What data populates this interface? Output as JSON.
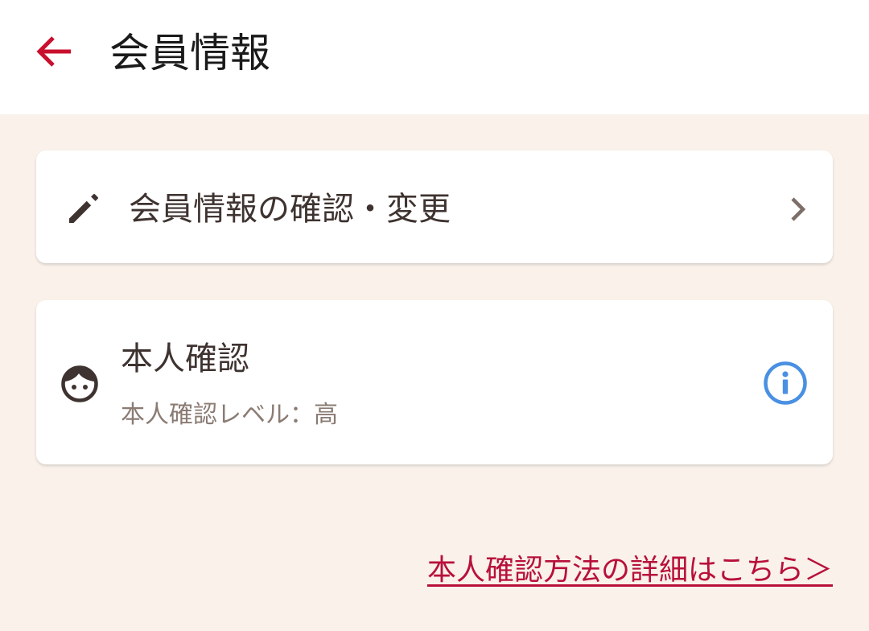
{
  "header": {
    "title": "会員情報",
    "back_icon": "arrow-left-icon",
    "accent_color": "#c8102e"
  },
  "edit_card": {
    "icon": "pencil-icon",
    "label": "会員情報の確認・変更",
    "chevron_icon": "chevron-right-icon"
  },
  "verify_card": {
    "icon": "face-icon",
    "title": "本人確認",
    "level_text": "本人確認レベル：高",
    "info_icon": "info-icon",
    "info_color": "#4a90e2"
  },
  "details_link": {
    "label": "本人確認方法の詳細はこちら＞",
    "color": "#b8103a"
  },
  "colors": {
    "background": "#f9f1ea",
    "card": "#ffffff",
    "text_primary": "#3e3330",
    "text_secondary": "#8a7b73"
  }
}
